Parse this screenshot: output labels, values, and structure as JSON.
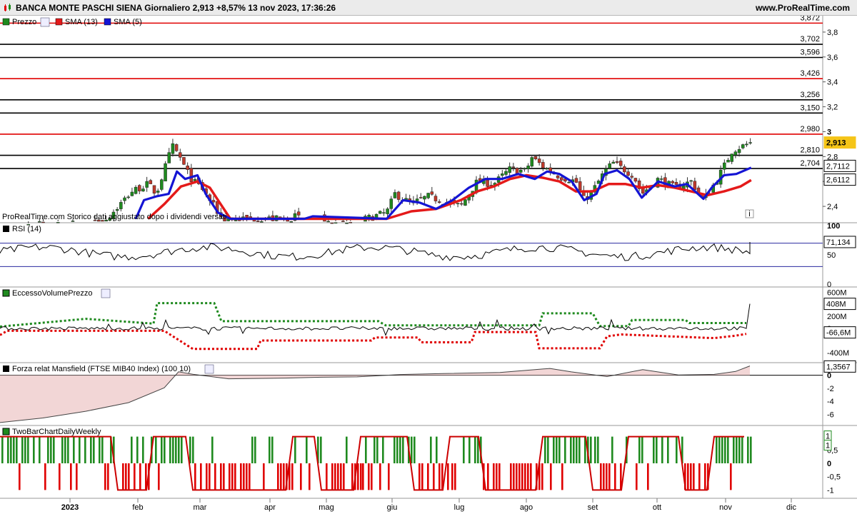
{
  "header": {
    "title": "BANCA MONTE PASCHI SIENA Giornaliero 2,913 +8,57% 13 nov 2023, 17:36:26",
    "site": "www.ProRealTime.com"
  },
  "colors": {
    "up": "#1f8a1f",
    "down": "#e00000",
    "sma13": "#e41a1a",
    "sma5": "#1414d4",
    "last_badge": "#f5c518"
  },
  "months": [
    "2023",
    "feb",
    "mar",
    "apr",
    "mag",
    "giu",
    "lug",
    "ago",
    "set",
    "ott",
    "nov",
    "dic"
  ],
  "price_panel": {
    "legend": [
      "Prezzo",
      "SMA (13)",
      "SMA (5)"
    ],
    "axis_ticks": [
      "3,8",
      "3,6",
      "3,4",
      "3,2",
      "3",
      "2,8",
      "2,6",
      "2,4"
    ],
    "levels": [
      {
        "value": 3.872,
        "label": "3,872",
        "color": "#e00000"
      },
      {
        "value": 3.702,
        "label": "3,702",
        "color": "#000000"
      },
      {
        "value": 3.596,
        "label": "3,596",
        "color": "#000000"
      },
      {
        "value": 3.426,
        "label": "3,426",
        "color": "#e00000"
      },
      {
        "value": 3.256,
        "label": "3,256",
        "color": "#000000"
      },
      {
        "value": 3.15,
        "label": "3,150",
        "color": "#000000"
      },
      {
        "value": 2.98,
        "label": "2,980",
        "color": "#e00000"
      },
      {
        "value": 2.81,
        "label": "2,810",
        "color": "#000000"
      },
      {
        "value": 2.704,
        "label": "2,704",
        "color": "#000000"
      }
    ],
    "last_price": "2,913",
    "sma5_value": "2,7112",
    "sma13_value": "2,6112",
    "note": "ProRealTime.com Storico dati aggiustato dopo i dividendi versati"
  },
  "rsi_panel": {
    "legend": "RSI (14)",
    "axis_ticks": [
      "100",
      "50",
      "0"
    ],
    "value": "71,134",
    "levels": [
      70,
      30
    ]
  },
  "volume_panel": {
    "legend": "EccessoVolumePrezzo",
    "axis_ticks": [
      "600M",
      "400M",
      "200M",
      "0",
      "-400M"
    ],
    "value_up": "408M",
    "value_zero": "0",
    "value_down": "-66,6M"
  },
  "mansfield_panel": {
    "legend": "Forza relat Mansfield (FTSE MIB40 Index) (100 10)",
    "axis_ticks": [
      "0",
      "-2",
      "-4",
      "-6"
    ],
    "value": "1,3567"
  },
  "twobar_panel": {
    "legend": "TwoBarChartDailyWeekly",
    "axis_ticks": [
      "1",
      "0,5",
      "0",
      "-0,5",
      "-1"
    ],
    "value_a": "1",
    "value_b": "1"
  },
  "chart_data": {
    "type": "candlestick",
    "title": "BANCA MONTE PASCHI SIENA Giornaliero",
    "last": 2.913,
    "change_pct": 8.57,
    "date": "13 nov 2023",
    "price_axis_range": [
      2.28,
      3.92
    ],
    "price_series": [
      {
        "name": "Prezzo",
        "points": [
          [
            0.03,
            2.27
          ],
          [
            0.08,
            2.25
          ],
          [
            0.13,
            2.3
          ],
          [
            0.16,
            2.52
          ],
          [
            0.18,
            2.58
          ],
          [
            0.19,
            2.5
          ],
          [
            0.205,
            2.8
          ],
          [
            0.21,
            2.88
          ],
          [
            0.22,
            2.78
          ],
          [
            0.225,
            2.7
          ],
          [
            0.235,
            2.6
          ],
          [
            0.245,
            2.55
          ],
          [
            0.255,
            2.45
          ],
          [
            0.27,
            2.3
          ],
          [
            0.35,
            2.3
          ],
          [
            0.36,
            2.32
          ],
          [
            0.37,
            2.28
          ],
          [
            0.4,
            2.25
          ],
          [
            0.43,
            2.27
          ],
          [
            0.47,
            2.35
          ],
          [
            0.48,
            2.5
          ],
          [
            0.5,
            2.42
          ],
          [
            0.52,
            2.48
          ],
          [
            0.56,
            2.4
          ],
          [
            0.58,
            2.6
          ],
          [
            0.6,
            2.58
          ],
          [
            0.62,
            2.7
          ],
          [
            0.64,
            2.68
          ],
          [
            0.645,
            2.8
          ],
          [
            0.66,
            2.72
          ],
          [
            0.68,
            2.64
          ],
          [
            0.7,
            2.6
          ],
          [
            0.71,
            2.45
          ],
          [
            0.72,
            2.52
          ],
          [
            0.735,
            2.68
          ],
          [
            0.745,
            2.75
          ],
          [
            0.77,
            2.65
          ],
          [
            0.78,
            2.5
          ],
          [
            0.8,
            2.62
          ],
          [
            0.82,
            2.55
          ],
          [
            0.84,
            2.6
          ],
          [
            0.855,
            2.45
          ],
          [
            0.87,
            2.6
          ],
          [
            0.88,
            2.72
          ],
          [
            0.89,
            2.85
          ],
          [
            0.913,
            2.913
          ]
        ]
      },
      {
        "name": "SMA (13)",
        "points": [
          [
            0.18,
            2.3
          ],
          [
            0.2,
            2.42
          ],
          [
            0.22,
            2.56
          ],
          [
            0.24,
            2.6
          ],
          [
            0.255,
            2.55
          ],
          [
            0.27,
            2.4
          ],
          [
            0.28,
            2.3
          ],
          [
            0.47,
            2.3
          ],
          [
            0.5,
            2.36
          ],
          [
            0.53,
            2.38
          ],
          [
            0.56,
            2.45
          ],
          [
            0.58,
            2.52
          ],
          [
            0.6,
            2.56
          ],
          [
            0.62,
            2.62
          ],
          [
            0.64,
            2.65
          ],
          [
            0.66,
            2.63
          ],
          [
            0.68,
            2.6
          ],
          [
            0.7,
            2.52
          ],
          [
            0.72,
            2.52
          ],
          [
            0.74,
            2.58
          ],
          [
            0.76,
            2.58
          ],
          [
            0.78,
            2.55
          ],
          [
            0.8,
            2.57
          ],
          [
            0.82,
            2.55
          ],
          [
            0.84,
            2.52
          ],
          [
            0.86,
            2.49
          ],
          [
            0.88,
            2.52
          ],
          [
            0.9,
            2.56
          ],
          [
            0.913,
            2.611
          ]
        ]
      },
      {
        "name": "SMA (5)",
        "points": [
          [
            0.165,
            2.3
          ],
          [
            0.175,
            2.45
          ],
          [
            0.19,
            2.48
          ],
          [
            0.205,
            2.5
          ],
          [
            0.215,
            2.68
          ],
          [
            0.225,
            2.62
          ],
          [
            0.24,
            2.65
          ],
          [
            0.25,
            2.5
          ],
          [
            0.265,
            2.35
          ],
          [
            0.28,
            2.3
          ],
          [
            0.37,
            2.3
          ],
          [
            0.38,
            2.32
          ],
          [
            0.47,
            2.3
          ],
          [
            0.49,
            2.45
          ],
          [
            0.51,
            2.43
          ],
          [
            0.53,
            2.38
          ],
          [
            0.55,
            2.45
          ],
          [
            0.57,
            2.55
          ],
          [
            0.59,
            2.62
          ],
          [
            0.61,
            2.62
          ],
          [
            0.63,
            2.66
          ],
          [
            0.65,
            2.62
          ],
          [
            0.665,
            2.68
          ],
          [
            0.68,
            2.66
          ],
          [
            0.695,
            2.6
          ],
          [
            0.71,
            2.45
          ],
          [
            0.725,
            2.5
          ],
          [
            0.735,
            2.66
          ],
          [
            0.75,
            2.69
          ],
          [
            0.765,
            2.62
          ],
          [
            0.78,
            2.47
          ],
          [
            0.8,
            2.6
          ],
          [
            0.82,
            2.56
          ],
          [
            0.835,
            2.58
          ],
          [
            0.855,
            2.46
          ],
          [
            0.865,
            2.55
          ],
          [
            0.88,
            2.65
          ],
          [
            0.895,
            2.66
          ],
          [
            0.913,
            2.711
          ]
        ]
      }
    ]
  }
}
